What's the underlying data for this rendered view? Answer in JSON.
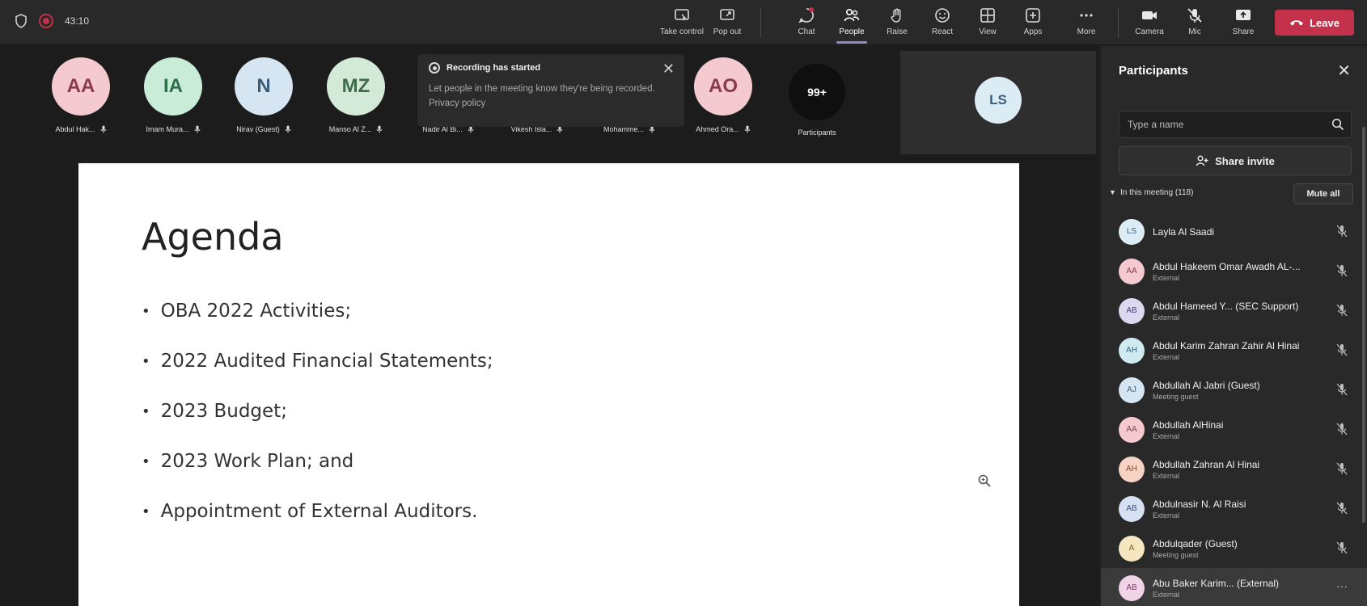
{
  "topbar": {
    "timer": "43:10",
    "controls": [
      {
        "label": "Take control",
        "icon": "take-control-icon"
      },
      {
        "label": "Pop out",
        "icon": "pop-out-icon"
      },
      {
        "label": "Chat",
        "icon": "chat-icon"
      },
      {
        "label": "People",
        "icon": "people-icon"
      },
      {
        "label": "Raise",
        "icon": "raise-hand-icon"
      },
      {
        "label": "React",
        "icon": "react-icon"
      },
      {
        "label": "View",
        "icon": "view-icon"
      },
      {
        "label": "Apps",
        "icon": "apps-icon"
      },
      {
        "label": "More",
        "icon": "more-icon"
      },
      {
        "label": "Camera",
        "icon": "camera-icon"
      },
      {
        "label": "Mic",
        "icon": "mic-icon"
      },
      {
        "label": "Share",
        "icon": "share-icon"
      }
    ],
    "leave_label": "Leave",
    "leave_color": "#c4314b",
    "active_tab": "People"
  },
  "tiles": [
    {
      "initials": "AA",
      "name": "Abdul Hak...",
      "bg": "#f4c9cf",
      "fg": "#8b3a4a"
    },
    {
      "initials": "IA",
      "name": "Imam Mura...",
      "bg": "#c9ecd8",
      "fg": "#2d6e4a"
    },
    {
      "initials": "N",
      "name": "Nirav (Guest)",
      "bg": "#d5e6f2",
      "fg": "#3a5e7a"
    },
    {
      "initials": "MZ",
      "name": "Manso Al Z...",
      "bg": "#d3ead9",
      "fg": "#3d6b4a"
    },
    {
      "initials": "",
      "name": "Nadir Al Bi...",
      "bg": "",
      "fg": ""
    },
    {
      "initials": "",
      "name": "Vikesh Isla...",
      "bg": "",
      "fg": ""
    },
    {
      "initials": "",
      "name": "Mohamme...",
      "bg": "",
      "fg": ""
    },
    {
      "initials": "AO",
      "name": "Ahmed Ora...",
      "bg": "#f4c9cf",
      "fg": "#8b3a4a"
    }
  ],
  "toast": {
    "title": "Recording has started",
    "body": "Let people in the meeting know they're being recorded. Privacy policy"
  },
  "participants_tile": {
    "count": "99+",
    "label": "Participants"
  },
  "self_view": {
    "initials": "LS",
    "bg": "#dcecf5",
    "fg": "#3a5e7a"
  },
  "slide": {
    "title": "Agenda",
    "bullets": [
      "OBA 2022 Activities;",
      "2022 Audited Financial Statements;",
      "2023 Budget;",
      "2023 Work Plan; and",
      "Appointment of External Auditors."
    ]
  },
  "panel": {
    "title": "Participants",
    "search_placeholder": "Type a name",
    "share_invite_label": "Share invite",
    "in_meeting_label": "In this meeting (118)",
    "mute_all_label": "Mute all",
    "people": [
      {
        "initials": "LS",
        "name": "Layla Al Saadi",
        "sub": "",
        "bg": "#dcecf5",
        "fg": "#3a5e7a"
      },
      {
        "initials": "AA",
        "name": "Abdul Hakeem Omar Awadh AL-...",
        "sub": "External",
        "bg": "#f4c9cf",
        "fg": "#8b3a4a"
      },
      {
        "initials": "AB",
        "name": "Abdul Hameed Y... (SEC Support)",
        "sub": "External",
        "bg": "#dcd8f0",
        "fg": "#4a447a"
      },
      {
        "initials": "AH",
        "name": "Abdul Karim Zahran Zahir Al Hinai",
        "sub": "External",
        "bg": "#cfeaf0",
        "fg": "#356a77"
      },
      {
        "initials": "AJ",
        "name": "Abdullah Al Jabri (Guest)",
        "sub": "Meeting guest",
        "bg": "#d5e6f2",
        "fg": "#3a5e7a"
      },
      {
        "initials": "AA",
        "name": "Abdullah AlHinai",
        "sub": "External",
        "bg": "#f4c9cf",
        "fg": "#8b3a4a"
      },
      {
        "initials": "AH",
        "name": "Abdullah Zahran Al Hinai",
        "sub": "External",
        "bg": "#f6d3c4",
        "fg": "#8a4d32"
      },
      {
        "initials": "AB",
        "name": "Abdulnasir N. Al Raisi",
        "sub": "External",
        "bg": "#d5e0f2",
        "fg": "#3a4e7a"
      },
      {
        "initials": "A",
        "name": "Abdulqader (Guest)",
        "sub": "Meeting guest",
        "bg": "#f6e6c0",
        "fg": "#7a6020"
      },
      {
        "initials": "AB",
        "name": "Abu Baker Karim... (External)",
        "sub": "External",
        "bg": "#f0d3e6",
        "fg": "#7a3a64"
      }
    ]
  }
}
